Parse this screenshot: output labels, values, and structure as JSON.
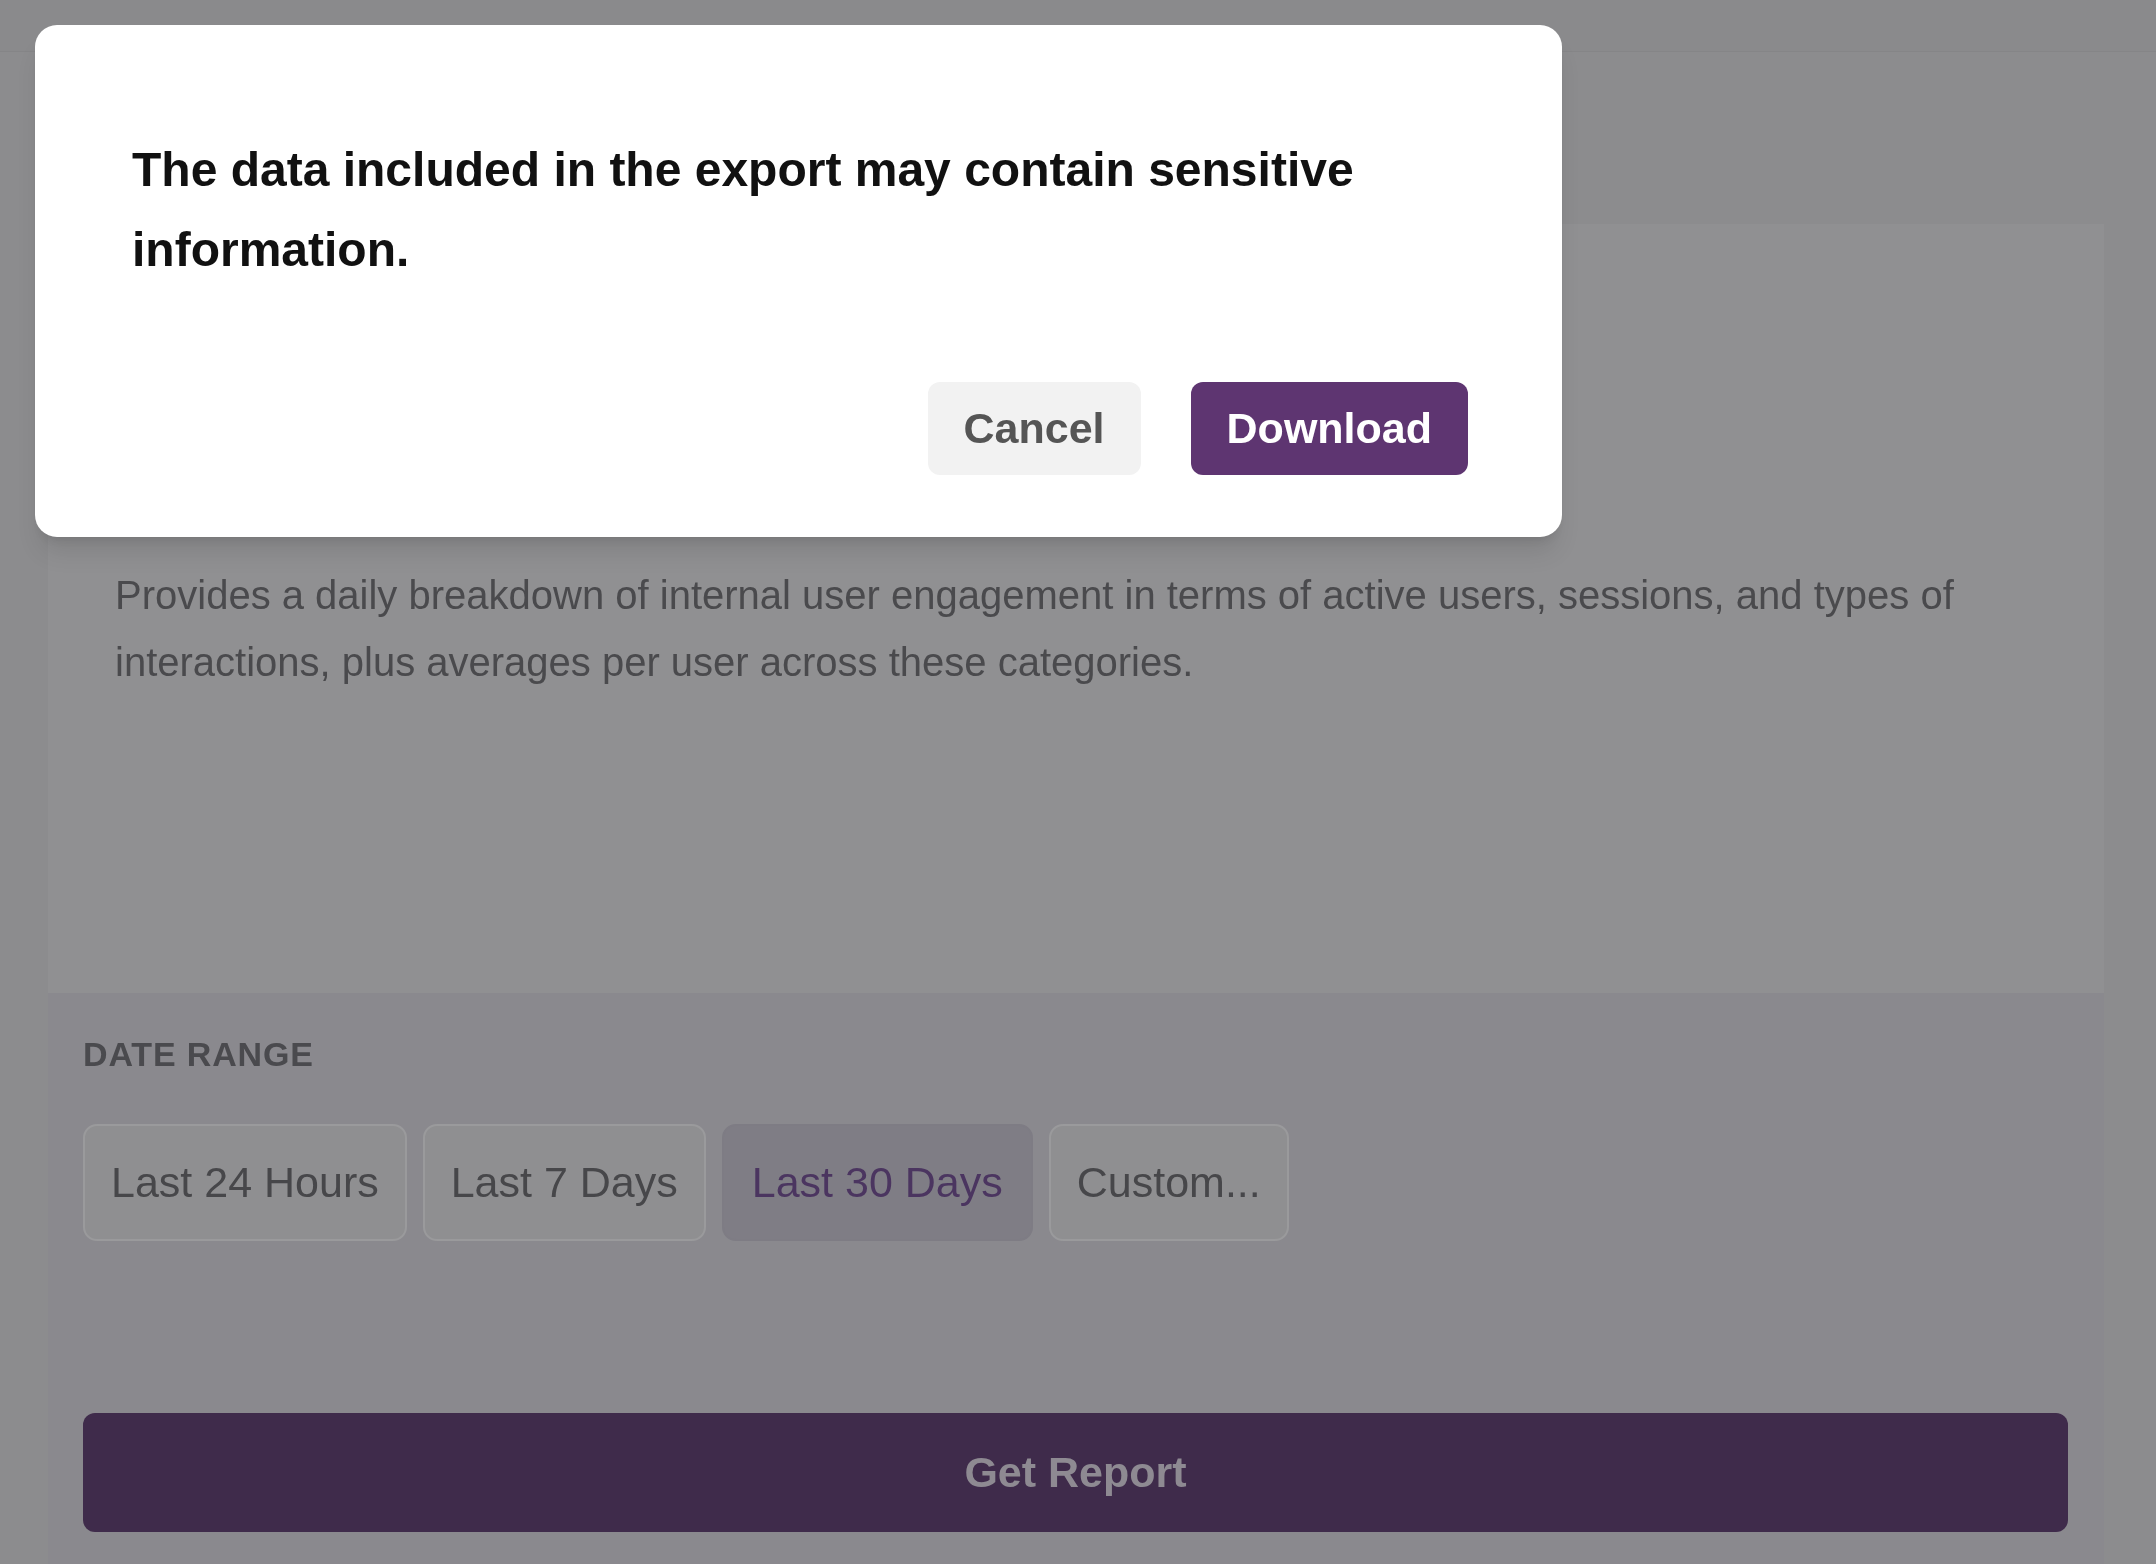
{
  "dialog": {
    "message": "The data included in the export may contain sensitive information.",
    "buttons": [
      {
        "label": "Cancel",
        "kind": "secondary"
      },
      {
        "label": "Download",
        "kind": "primary"
      }
    ]
  },
  "report": {
    "description": "Provides a daily breakdown of internal user engagement in terms of active users, sessions, and types of interactions, plus averages per user across these categories.",
    "date_range": {
      "label": "DATE RANGE",
      "options": [
        {
          "label": "Last 24 Hours",
          "selected": false
        },
        {
          "label": "Last 7 Days",
          "selected": false
        },
        {
          "label": "Last 30 Days",
          "selected": true
        },
        {
          "label": "Custom...",
          "selected": false
        }
      ]
    },
    "submit": "Get Report"
  }
}
